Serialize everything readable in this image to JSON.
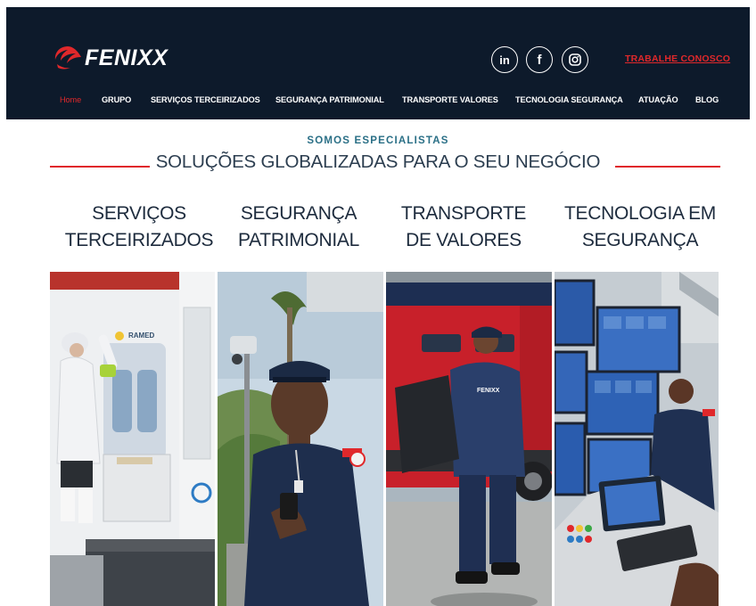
{
  "brand": {
    "name": "FENIXX",
    "colors": {
      "header_bg": "#0d1a2b",
      "accent_red": "#e0282b",
      "teal": "#2a6f86",
      "title_text": "#1d2b3d"
    }
  },
  "header": {
    "social": [
      {
        "icon": "linkedin-icon",
        "glyph": "in"
      },
      {
        "icon": "facebook-icon",
        "glyph": "f"
      },
      {
        "icon": "instagram-icon",
        "glyph": ""
      }
    ],
    "work_link": "TRABALHE CONOSCO"
  },
  "nav": {
    "items": [
      "Home",
      "GRUPO",
      "SERVIÇOS TERCEIRIZADOS",
      "SEGURANÇA PATRIMONIAL",
      "TRANSPORTE VALORES",
      "TECNOLOGIA SEGURANÇA",
      "ATUAÇÃO",
      "BLOG"
    ],
    "active": "Home"
  },
  "intro": {
    "eyebrow": "SOMOS ESPECIALISTAS",
    "headline": "SOLUÇÕES GLOBALIZADAS PARA O SEU NEGÓCIO"
  },
  "services": [
    {
      "line1": "SERVIÇOS",
      "line2": "TERCEIRIZADOS",
      "photo": "ambulance-cleaning-photo"
    },
    {
      "line1": "SEGURANÇA",
      "line2": "PATRIMONIAL",
      "photo": "security-guard-photo"
    },
    {
      "line1": "TRANSPORTE",
      "line2": "DE VALORES",
      "photo": "armored-truck-photo"
    },
    {
      "line1": "TECNOLOGIA EM",
      "line2": "SEGURANÇA",
      "photo": "monitoring-center-photo"
    }
  ],
  "photo_texts": {
    "ambulance_label": "RAMED",
    "vest_logo": "FENIXX"
  }
}
